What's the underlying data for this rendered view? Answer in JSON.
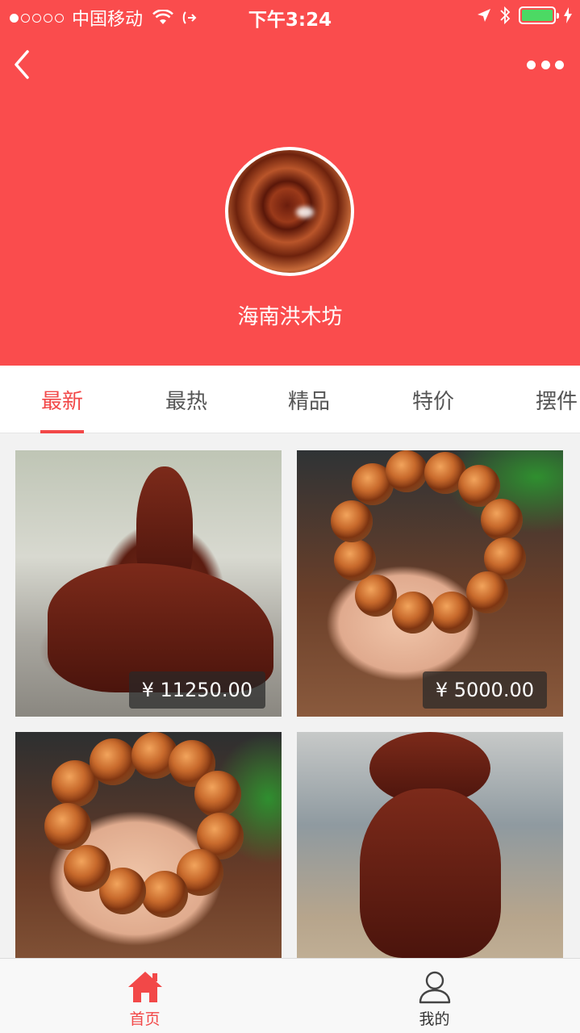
{
  "status_bar": {
    "carrier": "中国移动",
    "time": "下午3:24"
  },
  "header": {
    "shop_name": "海南洪木坊",
    "accent_color": "#fa4c4d",
    "back_icon": "chevron-left-icon",
    "more_icon": "more-dots-icon"
  },
  "tabs": [
    {
      "label": "最新",
      "active": true
    },
    {
      "label": "最热",
      "active": false
    },
    {
      "label": "精品",
      "active": false
    },
    {
      "label": "特价",
      "active": false
    },
    {
      "label": "摆件",
      "active": false
    }
  ],
  "products": [
    {
      "price": "¥ 11250.00"
    },
    {
      "price": "¥ 5000.00"
    },
    {
      "price": ""
    },
    {
      "price": ""
    }
  ],
  "bottom_nav": {
    "home": {
      "label": "首页",
      "icon": "home-icon",
      "active": true
    },
    "me": {
      "label": "我的",
      "icon": "user-icon",
      "active": false
    }
  }
}
